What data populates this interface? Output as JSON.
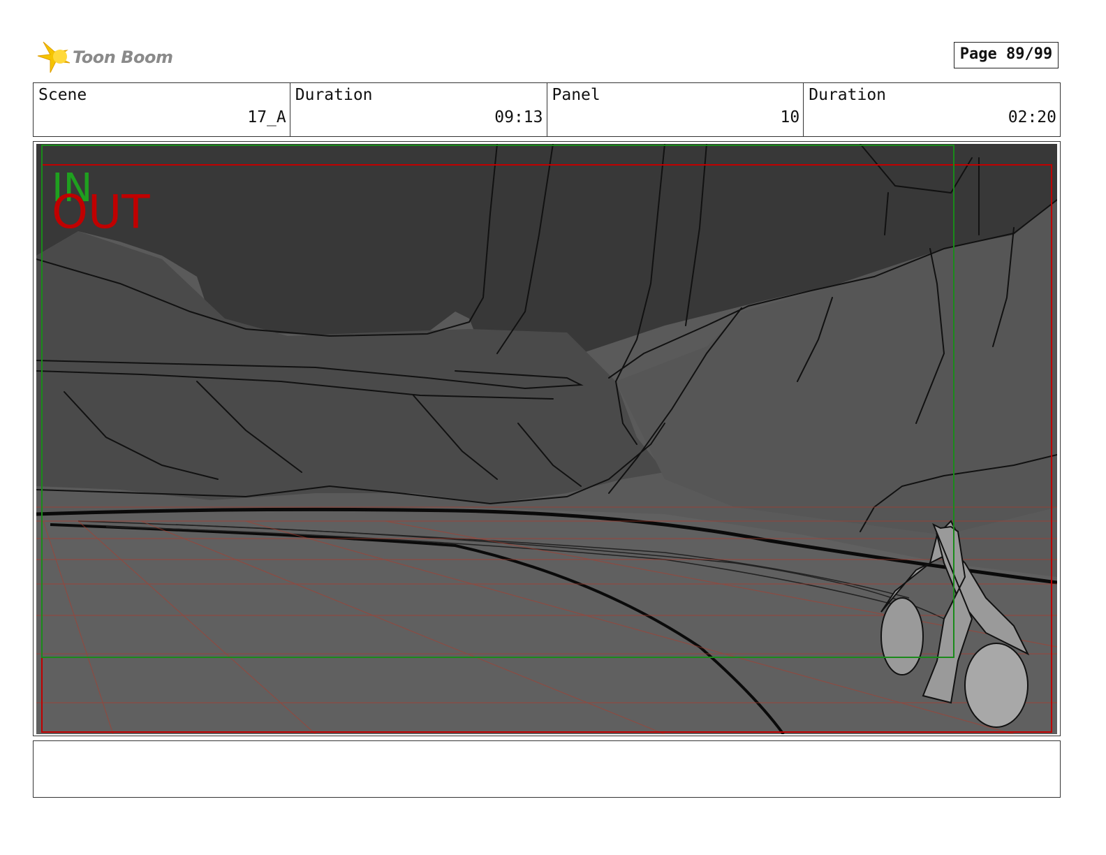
{
  "header": {
    "logo_text": "Toon Boom",
    "page": "Page 89/99"
  },
  "info": {
    "scene_label": "Scene",
    "scene_value": "17_A",
    "scene_duration_label": "Duration",
    "scene_duration_value": "09:13",
    "panel_label": "Panel",
    "panel_value": "10",
    "panel_duration_label": "Duration",
    "panel_duration_value": "02:20"
  },
  "panel": {
    "in_marker": "IN",
    "out_marker": "OUT"
  },
  "notes": {
    "text": ""
  },
  "colors": {
    "in_marker": "#1fa01f",
    "out_marker": "#c00000",
    "background_sketch": "#5a5a5a"
  }
}
